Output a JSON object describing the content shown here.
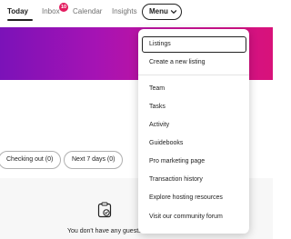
{
  "nav": {
    "today": "Today",
    "inbox": "Inbox",
    "inbox_badge": "10",
    "calendar": "Calendar",
    "insights": "Insights",
    "menu": "Menu"
  },
  "banner": {
    "gradient_start": "#7b12b8",
    "gradient_end": "#d8127a"
  },
  "filters": {
    "checking_out": "Checking out (0)",
    "next_7_days": "Next 7 days (0)"
  },
  "empty_state": {
    "icon": "clipboard-check-icon",
    "text": "You don't have any guests"
  },
  "menu_items": {
    "listings": "Listings",
    "create_listing": "Create a new listing",
    "team": "Team",
    "tasks": "Tasks",
    "activity": "Activity",
    "guidebooks": "Guidebooks",
    "pro_marketing": "Pro marketing page",
    "transaction_history": "Transaction history",
    "explore_resources": "Explore hosting resources",
    "community_forum": "Visit our community forum"
  },
  "colors": {
    "badge": "#e31c5f",
    "text": "#222222",
    "muted": "#717171"
  }
}
